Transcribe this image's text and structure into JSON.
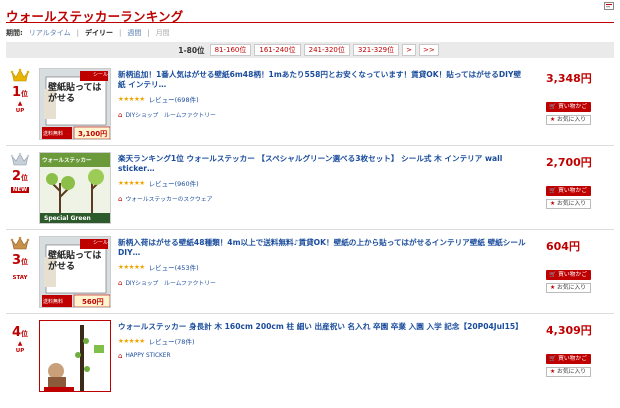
{
  "header": {
    "title": "ウォールステッカーランキング",
    "corner_icon": "rss-icon"
  },
  "period": {
    "label": "期間:",
    "options": [
      "リアルタイム",
      "デイリー",
      "週間",
      "月間"
    ],
    "active": "デイリー"
  },
  "pager": {
    "current": "1-80位",
    "pages": [
      "81-160位",
      "161-240位",
      "241-320位",
      "321-329位"
    ],
    "next": ">",
    "last": ">>"
  },
  "items": [
    {
      "rank": "1",
      "rank_suffix": "位",
      "trend": "UP",
      "crown_color": "#e8b400",
      "name": "新柄追加！1番人気はがせる壁紙6m48柄！1mあたり558円とお安くなっています！賃貸OK！貼ってはがせるDIY壁紙 インテリ…",
      "stars": "★★★★★",
      "reviews": "レビュー(698件)",
      "shop": "DIYショップ　ルームファクトリー",
      "price": "3,348円",
      "cart_label": "買い物かご",
      "fav_label": "お気に入り",
      "thumb_text": "壁紙貼ってはがせる",
      "thumb_badge": "シール",
      "thumb_note": "送料無料",
      "thumb_price": "3,100円"
    },
    {
      "rank": "2",
      "rank_suffix": "位",
      "trend": "NEW",
      "crown_color": "#9aa6b4",
      "name": "楽天ランキング1位 ウォールステッカー 【スペシャルグリーン選べる3枚セット】 シール式 木 インテリア wall sticker…",
      "stars": "★★★★★",
      "reviews": "レビュー(960件)",
      "shop": "ウォールステッカーのスクウェア",
      "price": "2,700円",
      "cart_label": "買い物かご",
      "fav_label": "お気に入り",
      "thumb_text": "ウォールステッカー",
      "thumb_badge": "Special Green",
      "thumb_note": "",
      "thumb_price": ""
    },
    {
      "rank": "3",
      "rank_suffix": "位",
      "trend": "STAY",
      "crown_color": "#b8803a",
      "name": "新柄入荷はがせる壁紙48種類！4m以上で送料無料♪賃貸OK！壁紙の上から貼ってはがせるインテリア壁紙 壁紙シール DIY…",
      "stars": "★★★★★",
      "reviews": "レビュー(453件)",
      "shop": "DIYショップ　ルームファクトリー",
      "price": "604円",
      "cart_label": "買い物かご",
      "fav_label": "お気に入り",
      "thumb_text": "壁紙貼ってはがせる",
      "thumb_badge": "シール",
      "thumb_note": "送料無料",
      "thumb_price": "560円"
    },
    {
      "rank": "4",
      "rank_suffix": "位",
      "trend": "UP",
      "crown_color": "",
      "name": "ウォールステッカー 身長計 木 160cm 200cm 柱 細い 出産祝い 名入れ 卒園 卒業 入園 入学 記念【20P04Jul15】",
      "stars": "★★★★★",
      "reviews": "レビュー(78件)",
      "shop": "HAPPY STICKER",
      "price": "4,309円",
      "cart_label": "買い物かご",
      "fav_label": "お気に入り",
      "thumb_text": "",
      "thumb_badge": "",
      "thumb_note": "",
      "thumb_price": ""
    }
  ]
}
